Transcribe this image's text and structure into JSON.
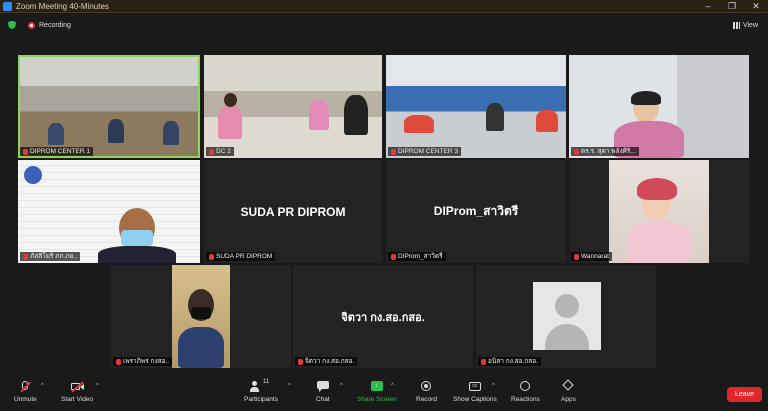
{
  "window": {
    "title": "Zoom Meeting 40-Minutes"
  },
  "top": {
    "recording": "Recording",
    "view": "View"
  },
  "tiles": [
    {
      "name": "DIPROM CENTER 1"
    },
    {
      "name": "DC 2"
    },
    {
      "name": "DIPROM CENTER 3"
    },
    {
      "name": "ดร.ร. สุดา พลังศิริ..."
    },
    {
      "name": "ภัสสิโมริ ภก.ภย.."
    },
    {
      "name": "SUDA PR DIPROM",
      "display": "SUDA PR DIPROM"
    },
    {
      "name": "DIProm_สาวิตรี",
      "display": "DIProm_สาวิตรี"
    },
    {
      "name": "Wannarat"
    },
    {
      "name": "เพราภิพร กงสอ.."
    },
    {
      "name": "จิตวา กง.สอ.กสอ.",
      "display": "จิตวา กง.สอ.กสอ."
    },
    {
      "name": "อนิสา กง.สอ.กสอ."
    }
  ],
  "toolbar": {
    "unmute": "Unmute",
    "start_video": "Start Video",
    "participants": "Participants",
    "participants_count": "11",
    "chat": "Chat",
    "share_screen": "Share Screen",
    "record": "Record",
    "show_captions": "Show Captions",
    "reactions": "Reactions",
    "apps": "Apps",
    "leave": "Leave"
  },
  "colors": {
    "accent_green": "#2dbf4e",
    "leave_red": "#e02828",
    "active_speaker": "#8ed35a"
  }
}
